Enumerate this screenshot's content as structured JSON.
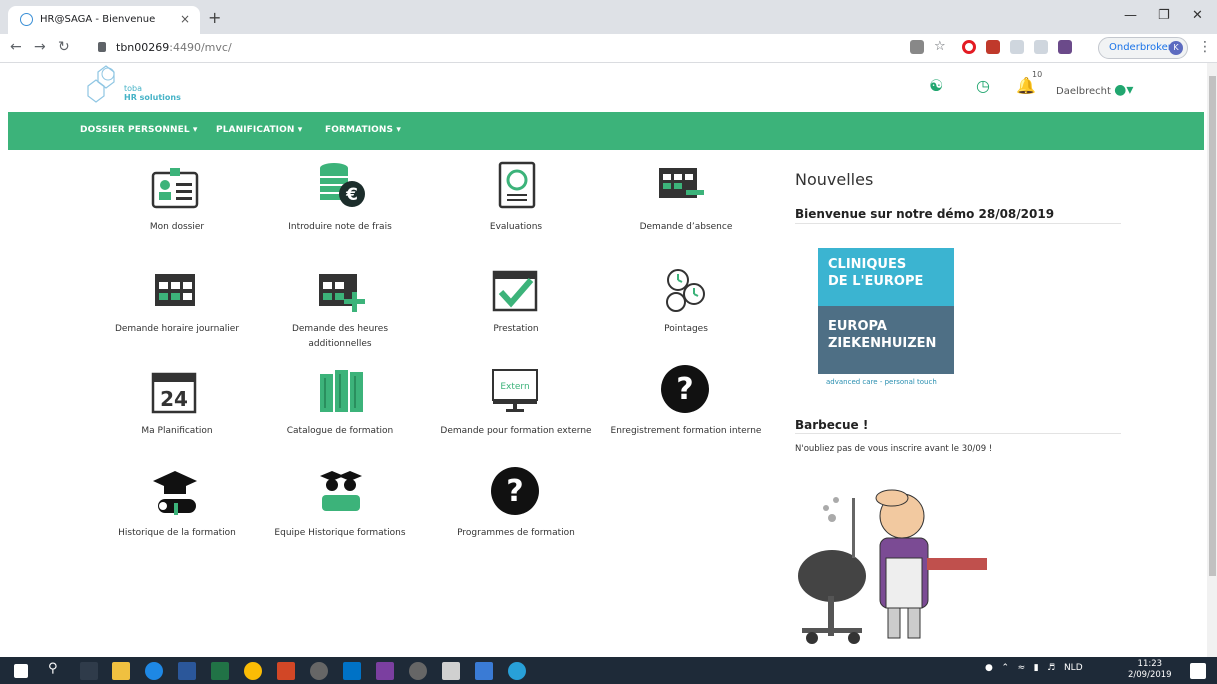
{
  "browser": {
    "tab_title": "HR@SAGA - Bienvenue",
    "tab_close": "×",
    "new_tab": "+",
    "url_host": "tbn00269",
    "url_rest": ":4490/mvc/",
    "paused_label": "Onderbroken",
    "avatar_letter": "K"
  },
  "app": {
    "logo_line1": "toba",
    "logo_line2": "HR solutions",
    "bell_count": "10",
    "username": "Daelbrecht",
    "accent_color": "#3cb37a"
  },
  "nav": {
    "items": [
      "DOSSIER PERSONNEL ▾",
      "PLANIFICATION ▾",
      "FORMATIONS ▾"
    ]
  },
  "tiles": [
    {
      "label": "Mon dossier",
      "icon": "id-card-icon"
    },
    {
      "label": "Introduire note de frais",
      "icon": "coins-euro-icon"
    },
    {
      "label": "Evaluations",
      "icon": "evaluation-doc-icon"
    },
    {
      "label": "Demande d’absence",
      "icon": "calendar-minus-icon"
    },
    {
      "label": "Demande horaire journalier",
      "icon": "calendar-icon"
    },
    {
      "label": "Demande des heures additionnelles",
      "icon": "calendar-plus-icon"
    },
    {
      "label": "Prestation",
      "icon": "calendar-check-icon"
    },
    {
      "label": "Pointages",
      "icon": "clocks-icon"
    },
    {
      "label": "Ma Planification",
      "icon": "calendar-24-icon"
    },
    {
      "label": "Catalogue de formation",
      "icon": "books-icon"
    },
    {
      "label": "Demande pour formation externe",
      "icon": "extern-screen-icon"
    },
    {
      "label": "Enregistrement formation interne",
      "icon": "question-icon"
    },
    {
      "label": "Historique de la formation",
      "icon": "graduation-icon"
    },
    {
      "label": "Equipe Historique formations",
      "icon": "team-graduation-icon"
    },
    {
      "label": "Programmes de formation",
      "icon": "question-icon"
    }
  ],
  "tile_texts": {
    "extern": "Extern",
    "day24": "24",
    "euro": "€"
  },
  "news": {
    "title": "Nouvelles",
    "item1_title": "Bienvenue sur notre démo 28/08/2019",
    "clinic_line1": "CLINIQUES",
    "clinic_line2": "DE L'EUROPE",
    "clinic_line3": "EUROPA",
    "clinic_line4": "ZIEKENHUIZEN",
    "clinic_tag": "advanced care - personal touch",
    "item2_title": "Barbecue !",
    "item2_text": "N'oubliez pas de vous inscrire avant le 30/09 !"
  },
  "taskbar": {
    "tray": "NLD",
    "time": "11:23",
    "date": "2/09/2019"
  }
}
